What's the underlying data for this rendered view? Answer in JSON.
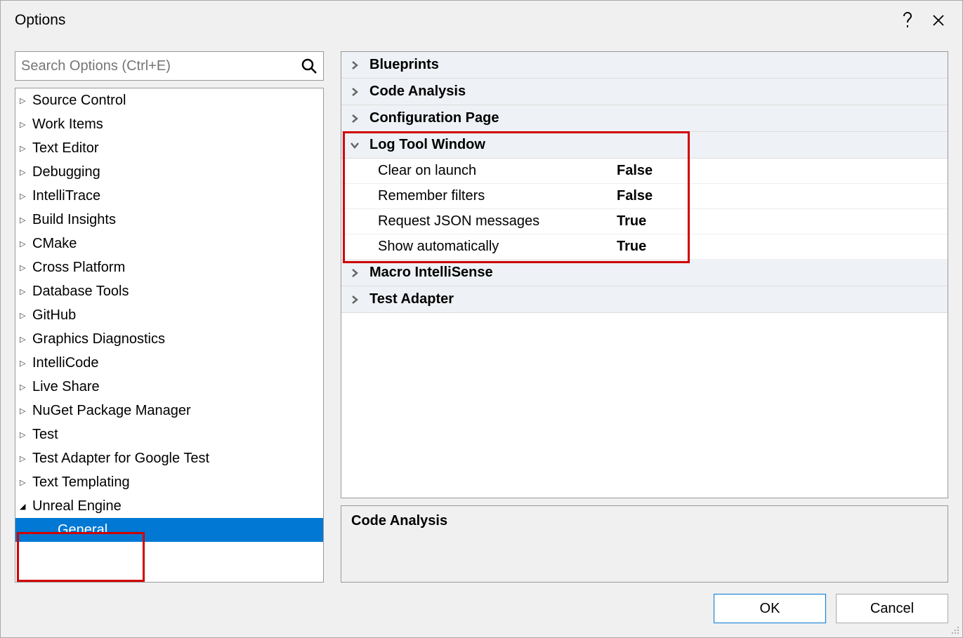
{
  "dialog": {
    "title": "Options"
  },
  "search": {
    "placeholder": "Search Options (Ctrl+E)"
  },
  "tree": {
    "items": [
      {
        "label": "Source Control",
        "expanded": false
      },
      {
        "label": "Work Items",
        "expanded": false
      },
      {
        "label": "Text Editor",
        "expanded": false
      },
      {
        "label": "Debugging",
        "expanded": false
      },
      {
        "label": "IntelliTrace",
        "expanded": false
      },
      {
        "label": "Build Insights",
        "expanded": false
      },
      {
        "label": "CMake",
        "expanded": false
      },
      {
        "label": "Cross Platform",
        "expanded": false
      },
      {
        "label": "Database Tools",
        "expanded": false
      },
      {
        "label": "GitHub",
        "expanded": false
      },
      {
        "label": "Graphics Diagnostics",
        "expanded": false
      },
      {
        "label": "IntelliCode",
        "expanded": false
      },
      {
        "label": "Live Share",
        "expanded": false
      },
      {
        "label": "NuGet Package Manager",
        "expanded": false
      },
      {
        "label": "Test",
        "expanded": false
      },
      {
        "label": "Test Adapter for Google Test",
        "expanded": false
      },
      {
        "label": "Text Templating",
        "expanded": false
      },
      {
        "label": "Unreal Engine",
        "expanded": true
      }
    ],
    "selected_child": "General"
  },
  "prop_sections": [
    {
      "label": "Blueprints",
      "expanded": false
    },
    {
      "label": "Code Analysis",
      "expanded": false
    },
    {
      "label": "Configuration Page",
      "expanded": false
    },
    {
      "label": "Log Tool Window",
      "expanded": true,
      "rows": [
        {
          "name": "Clear on launch",
          "value": "False"
        },
        {
          "name": "Remember filters",
          "value": "False"
        },
        {
          "name": "Request JSON messages",
          "value": "True"
        },
        {
          "name": "Show automatically",
          "value": "True"
        }
      ]
    },
    {
      "label": "Macro IntelliSense",
      "expanded": false
    },
    {
      "label": "Test Adapter",
      "expanded": false
    }
  ],
  "description": {
    "title": "Code Analysis"
  },
  "buttons": {
    "ok": "OK",
    "cancel": "Cancel"
  }
}
